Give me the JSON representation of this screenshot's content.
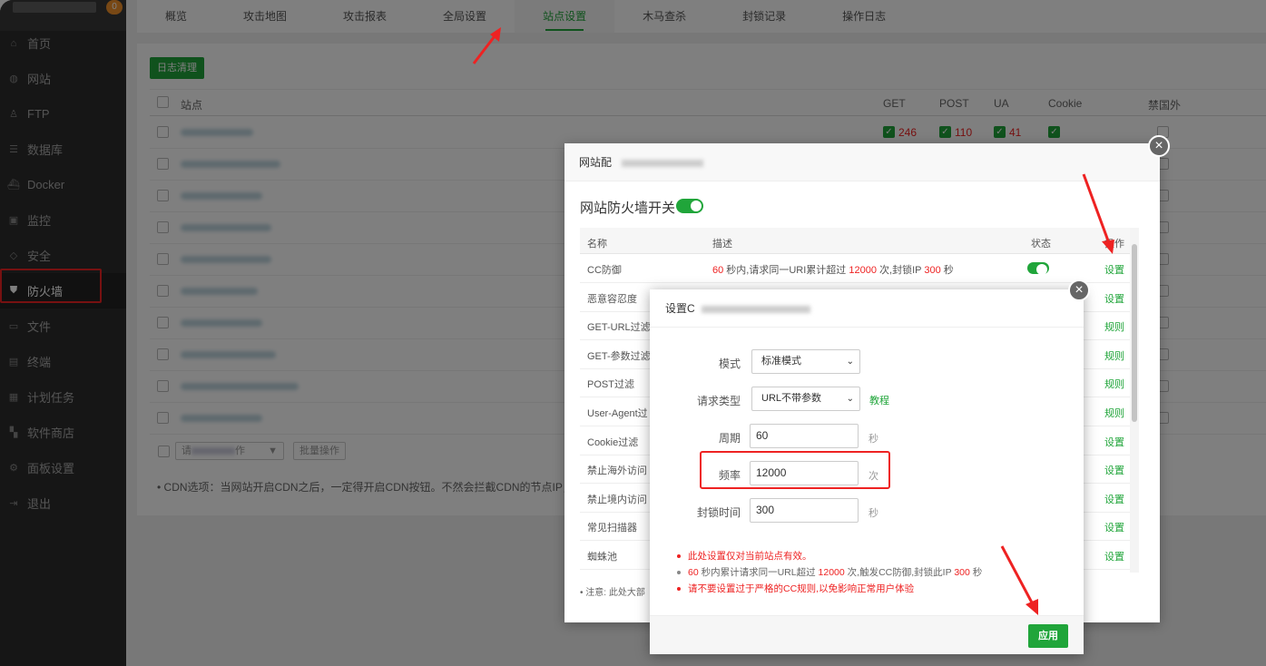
{
  "sidebar": {
    "badge": "0",
    "items": [
      {
        "label": "首页",
        "icon": "home-icon"
      },
      {
        "label": "网站",
        "icon": "globe-icon"
      },
      {
        "label": "FTP",
        "icon": "user-icon"
      },
      {
        "label": "数据库",
        "icon": "database-icon"
      },
      {
        "label": "Docker",
        "icon": "docker-icon"
      },
      {
        "label": "监控",
        "icon": "monitor-icon"
      },
      {
        "label": "安全",
        "icon": "shield-outline-icon"
      },
      {
        "label": "防火墙",
        "icon": "shield-icon"
      },
      {
        "label": "文件",
        "icon": "folder-icon"
      },
      {
        "label": "终端",
        "icon": "terminal-icon"
      },
      {
        "label": "计划任务",
        "icon": "calendar-icon"
      },
      {
        "label": "软件商店",
        "icon": "grid-icon"
      },
      {
        "label": "面板设置",
        "icon": "gear-icon"
      },
      {
        "label": "退出",
        "icon": "logout-icon"
      }
    ]
  },
  "tabs": [
    "概览",
    "攻击地图",
    "攻击报表",
    "全局设置",
    "站点设置",
    "木马查杀",
    "封锁记录",
    "操作日志"
  ],
  "panel": {
    "clear_log": "日志清理",
    "headers": {
      "site": "站点",
      "get": "GET",
      "post": "POST",
      "ua": "UA",
      "cookie": "Cookie",
      "foreign": "禁国外"
    },
    "first_row": {
      "get": "246",
      "post": "110",
      "ua": "41"
    },
    "batch_select": "请",
    "batch_select_tail": "作",
    "batch_button": "批量操作",
    "note": "CDN选项：当网站开启CDN之后，一定得开启CDN按钮。不然会拦截CDN的节点IP，如"
  },
  "dialog1": {
    "title": "网站配",
    "fw_switch_label": "网站防火墙开关",
    "col_name": "名称",
    "col_desc": "描述",
    "col_status": "状态",
    "col_action": "操作",
    "rows": [
      {
        "name": "CC防御",
        "action": "设置"
      },
      {
        "name": "恶意容忍度",
        "action": "设置"
      },
      {
        "name": "GET-URL过滤",
        "action": "规则"
      },
      {
        "name": "GET-参数过滤",
        "action": "规则"
      },
      {
        "name": "POST过滤",
        "action": "规则"
      },
      {
        "name": "User-Agent过",
        "action": "规则"
      },
      {
        "name": "Cookie过滤",
        "action": "设置"
      },
      {
        "name": "禁止海外访问",
        "action": "设置"
      },
      {
        "name": "禁止境内访问",
        "action": "设置"
      },
      {
        "name": "常见扫描器",
        "action": "设置"
      },
      {
        "name": "蜘蛛池",
        "action": "设置"
      }
    ],
    "cc_desc": {
      "a": "60",
      "b": " 秒内,请求同一URI累计超过 ",
      "c": "12000",
      "d": " 次,封锁IP ",
      "e": "300",
      "f": " 秒"
    },
    "bottom_note": "注意: 此处大部"
  },
  "dialog2": {
    "title": "设置C",
    "mode_label": "模式",
    "mode_value": "标准模式",
    "req_type_label": "请求类型",
    "req_type_value": "URL不带参数",
    "tutorial": "教程",
    "cycle_label": "周期",
    "cycle_value": "60",
    "cycle_unit": "秒",
    "freq_label": "频率",
    "freq_value": "12000",
    "freq_unit": "次",
    "block_label": "封锁时间",
    "block_value": "300",
    "block_unit": "秒",
    "tip1": "此处设置仅对当前站点有效。",
    "tip2": {
      "a": "60",
      "b": " 秒内累计请求同一URL超过 ",
      "c": "12000",
      "d": " 次,触发CC防御,封锁此IP ",
      "e": "300",
      "f": " 秒"
    },
    "tip3": "请不要设置过于严格的CC规则,以免影响正常用户体验",
    "apply": "应用"
  },
  "colors": {
    "accent": "#20a53a",
    "danger": "#e22222",
    "sidebar": "#2d2d2d"
  }
}
